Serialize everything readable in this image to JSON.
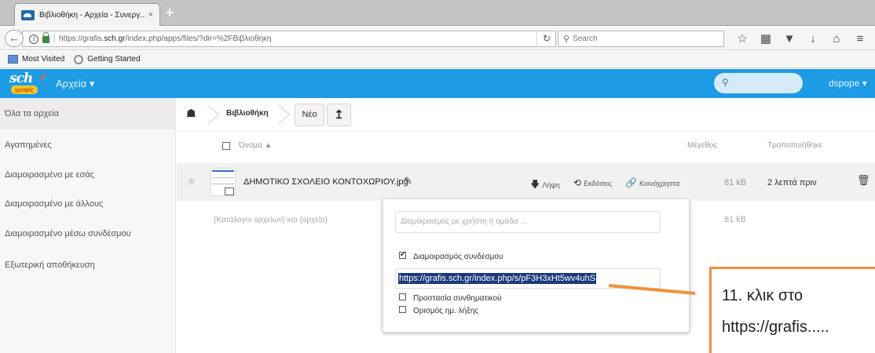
{
  "browser": {
    "tab_title": "Βιβλιοθήκη - Αρχεία - Συνεργ...",
    "tab_close": "×",
    "new_tab": "+",
    "url_prefix": "https://grafis.",
    "url_domain": "sch.gr",
    "url_suffix": "/index.php/apps/files/?dir=%2FBιβλιοθήκη",
    "search_placeholder": "Search",
    "bookmarks": [
      "Most Visited",
      "Getting Started"
    ]
  },
  "app": {
    "logo_text": "sch",
    "logo_sub": "γραφίς",
    "menu_label": "Αρχεία ▾",
    "user": "dspope ▾",
    "accent_color": "#1d9be5"
  },
  "sidebar": {
    "items": [
      "Όλα τα αρχεία",
      "Αγαπημένες",
      "Διαμοιρασμένο με εσάς",
      "Διαμοιρασμένο με άλλους",
      "Διαμοιρασμένο μέσω συνδέσμου",
      "Εξωτερική αποθήκευση"
    ]
  },
  "controls": {
    "breadcrumb_folder": "Βιβλιοθήκη",
    "new_button": "Νέο"
  },
  "table": {
    "col_name": "Όνομα ▲",
    "col_size": "Μέγεθος",
    "col_modified": "Τροποποιήθηκε",
    "file": {
      "name": "ΔΗΜΟΤΙΚΟ ΣΧΟΛΕΙΟ ΚΟΝΤΟΧΩΡΙΟΥ.jpg",
      "action_download": "Λήψη",
      "action_versions": "Εκδόσεις",
      "action_share": "Κοινόχρηστα",
      "size": "81 kB",
      "modified": "2 λεπτά πριν"
    },
    "summary_text": "{Κατάλογοι αρχείων} και {αρχεία}",
    "summary_size": "81 kB"
  },
  "share": {
    "with_placeholder": "Διαμοιρασμός με χρήστη ή ομάδα ...",
    "link_share_label": "Διαμοιρασμός συνδέσμου",
    "link_share_checked": true,
    "link_url": "https://grafis.sch.gr/index.php/s/pF3H3xHt5wv4uhS",
    "password_label": "Προστασία συνθηματικού",
    "expiry_label": "Ορισμός ημ. λήξης"
  },
  "annotation": {
    "line1": "11. κλικ στο",
    "line2": "https://grafis.....",
    "color": "#f0913a"
  }
}
